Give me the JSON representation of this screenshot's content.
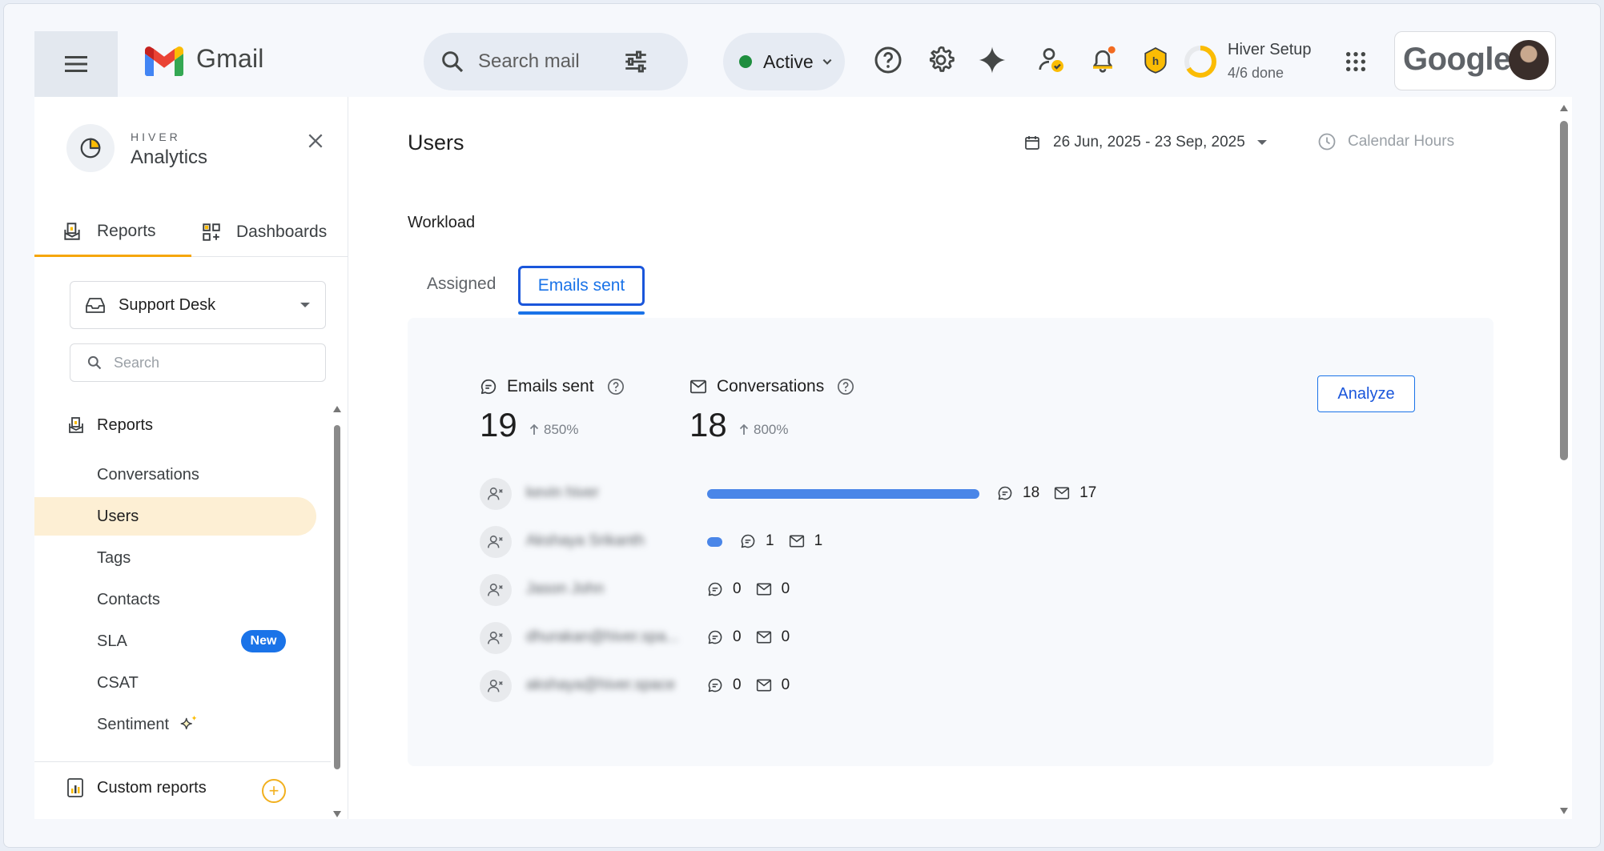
{
  "topbar": {
    "app_name": "Gmail",
    "search_placeholder": "Search mail",
    "status_label": "Active",
    "setup_title": "Hiver Setup",
    "setup_progress": "4/6 done",
    "setup_fraction": 0.667,
    "google_label": "Google",
    "icons": [
      "menu-icon",
      "search-icon",
      "tune-icon",
      "help-icon",
      "gear-icon",
      "gemini-icon",
      "user-check-icon",
      "bell-icon",
      "hiver-shield-icon",
      "apps-grid-icon"
    ]
  },
  "sidebar": {
    "brand_top": "HIVER",
    "brand_bottom": "Analytics",
    "tabs": [
      {
        "label": "Reports",
        "active": true
      },
      {
        "label": "Dashboards",
        "active": false
      }
    ],
    "inbox_select": "Support Desk",
    "search_placeholder": "Search",
    "section_label": "Reports",
    "items": [
      {
        "label": "Conversations"
      },
      {
        "label": "Users",
        "active": true
      },
      {
        "label": "Tags"
      },
      {
        "label": "Contacts"
      },
      {
        "label": "SLA",
        "badge": "New"
      },
      {
        "label": "CSAT"
      },
      {
        "label": "Sentiment"
      }
    ],
    "custom_reports": "Custom reports"
  },
  "main": {
    "title": "Users",
    "date_range": "26 Jun, 2025 - 23 Sep, 2025",
    "hours_mode": "Calendar Hours",
    "section": "Workload",
    "tabs": [
      {
        "label": "Assigned",
        "active": false
      },
      {
        "label": "Emails sent",
        "active": true
      }
    ],
    "metrics": [
      {
        "label": "Emails sent",
        "value": "19",
        "change": "850%"
      },
      {
        "label": "Conversations",
        "value": "18",
        "change": "800%"
      }
    ],
    "analyze_label": "Analyze",
    "users": [
      {
        "name": "kevin hiver",
        "emails": "18",
        "conversations": "17",
        "bar_fraction": 1.0
      },
      {
        "name": "Akshaya Srikanth",
        "emails": "1",
        "conversations": "1",
        "bar_fraction": 0.0556
      },
      {
        "name": "Jason John",
        "emails": "0",
        "conversations": "0",
        "bar_fraction": 0
      },
      {
        "name": "dhurakan@hiver.spa...",
        "emails": "0",
        "conversations": "0",
        "bar_fraction": 0
      },
      {
        "name": "akshaya@hiver.space",
        "emails": "0",
        "conversations": "0",
        "bar_fraction": 0
      }
    ]
  },
  "colors": {
    "accent_blue": "#1a73e8",
    "active_green": "#1e8e3e",
    "hiver_yellow": "#f6a609",
    "nav_active_bg": "#fdefd4",
    "bar_blue": "#4a86e8"
  }
}
